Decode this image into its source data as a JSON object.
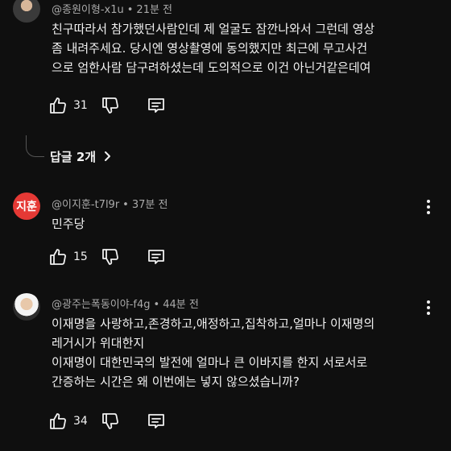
{
  "comments": [
    {
      "author": "@종원이형-x1u",
      "time": "21분 전",
      "avatar_initials": "",
      "lines": [
        "친구따라서 참가했던사람인데 제 얼굴도 잠깐나와서 그런데 영상",
        "좀 내려주세요. 당시엔 영상촬영에 동의했지만 최근에 무고사건",
        "으로 엄한사람 담구려하셨는데 도의적으로 이건 아닌거같은데여"
      ],
      "likes": "31",
      "replies_label": "답글 2개"
    },
    {
      "author": "@이지훈-t7l9r",
      "time": "37분 전",
      "avatar_initials": "지훈",
      "lines": [
        "민주당"
      ],
      "likes": "15"
    },
    {
      "author": "@광주는폭동이야-f4g",
      "time": "44분 전",
      "avatar_initials": "",
      "lines": [
        "이재명을 사랑하고,존경하고,애정하고,집착하고,얼마나 이재명의",
        "레거시가 위대한지",
        "이재명이 대한민국의 발전에 얼마나 큰 이바지를 한지 서로서로",
        "간증하는 시간은 왜 이번에는 넣지 않으셨습니까?"
      ],
      "likes": "34"
    }
  ],
  "icons": {
    "like": "thumbs-up-icon",
    "dislike": "thumbs-down-icon",
    "reply": "reply-icon",
    "more": "more-vertical-icon",
    "chevron": "chevron-right-icon"
  },
  "colors": {
    "background": "#0f0f0f",
    "text": "#f1f1f1",
    "meta": "#aaaaaa",
    "avatar_red": "#e53935"
  }
}
